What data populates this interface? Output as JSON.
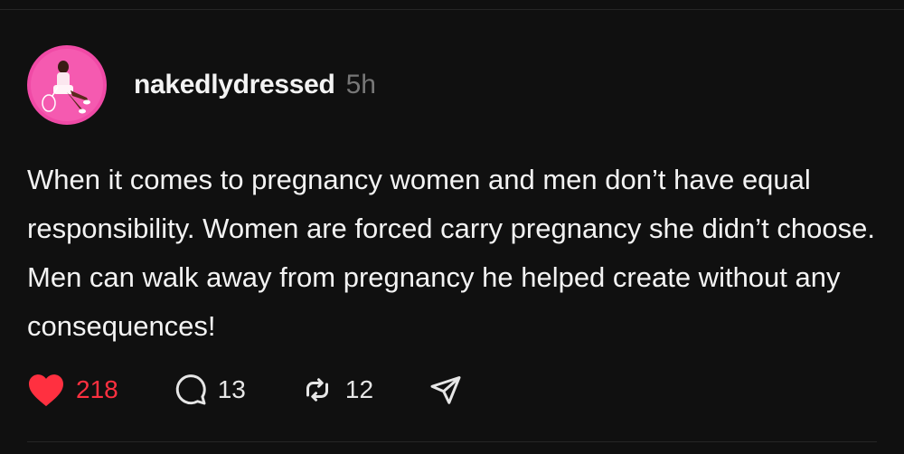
{
  "post": {
    "username": "nakedlydressed",
    "timestamp": "5h",
    "text": "When it comes to pregnancy women and men don’t have equal responsibility. Women are forced carry pregnancy she didn’t choose. Men can walk away from pregnancy he helped create without any consequences!",
    "avatar": {
      "alt": "profile photo",
      "background_color": "#f04aa6"
    },
    "actions": {
      "likes": "218",
      "replies": "13",
      "reposts": "12",
      "liked": true
    }
  },
  "colors": {
    "background": "#101010",
    "text": "#f3f3f3",
    "muted": "#777777",
    "like_red": "#ff3040",
    "divider": "#262626"
  },
  "icons": {
    "like": "heart-icon",
    "reply": "speech-bubble-icon",
    "repost": "repost-arrows-icon",
    "share": "paper-plane-icon"
  }
}
